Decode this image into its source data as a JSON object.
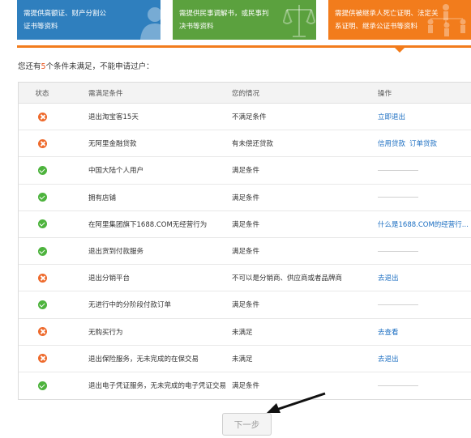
{
  "cards": [
    {
      "text": "需提供高额证、财产分割公\n证书等资料"
    },
    {
      "text": "需提供民事调解书，或民事判\n决书等资料"
    },
    {
      "text": "需提供被继承人死亡证明、法定关\n系证明、继承公证书等资料"
    }
  ],
  "notice": {
    "before": "您还有",
    "count": "5",
    "after": "个条件未满足，不能申请过户："
  },
  "table": {
    "headers": {
      "status": "状态",
      "condition": "需满足条件",
      "situation": "您的情况",
      "action": "操作"
    },
    "rows": [
      {
        "status": "error",
        "condition": "退出淘宝客15天",
        "situation": "不满足条件",
        "actions": [
          "立即退出"
        ]
      },
      {
        "status": "error",
        "condition": "无阿里金融贷款",
        "situation": "有未偿还贷款",
        "actions": [
          "信用贷款",
          "订单贷款"
        ]
      },
      {
        "status": "ok",
        "condition": "中国大陆个人用户",
        "situation": "满足条件",
        "actions": []
      },
      {
        "status": "ok",
        "condition": "拥有店铺",
        "situation": "满足条件",
        "actions": []
      },
      {
        "status": "ok",
        "condition": "在阿里集团旗下1688.COM无经营行为",
        "situation": "满足条件",
        "actions": [
          "什么是1688.COM的经营行..."
        ]
      },
      {
        "status": "ok",
        "condition": "退出货到付款服务",
        "situation": "满足条件",
        "actions": []
      },
      {
        "status": "error",
        "condition": "退出分销平台",
        "situation": "不可以是分销商、供应商或者品牌商",
        "actions": [
          "去退出"
        ]
      },
      {
        "status": "ok",
        "condition": "无进行中的分阶段付款订单",
        "situation": "满足条件",
        "actions": []
      },
      {
        "status": "error",
        "condition": "无购买行为",
        "situation": "未满足",
        "actions": [
          "去查看"
        ]
      },
      {
        "status": "error",
        "condition": "退出保险服务，无未完成的在保交易",
        "situation": "未满足",
        "actions": [
          "去退出"
        ]
      },
      {
        "status": "ok",
        "condition": "退出电子凭证服务，无未完成的电子凭证交易",
        "situation": "满足条件",
        "actions": []
      }
    ]
  },
  "next_button": {
    "label": "下一步"
  },
  "colors": {
    "blue": "#2f7fbe",
    "green": "#5ba13e",
    "orange": "#f27c1c",
    "link": "#1b6ec2",
    "error": "#ee6a2c",
    "ok": "#4db33d"
  },
  "icons": {
    "card1": "person-icon",
    "card2": "scales-icon",
    "card3": "family-icon",
    "error": "error-circle-icon",
    "ok": "check-circle-icon"
  }
}
